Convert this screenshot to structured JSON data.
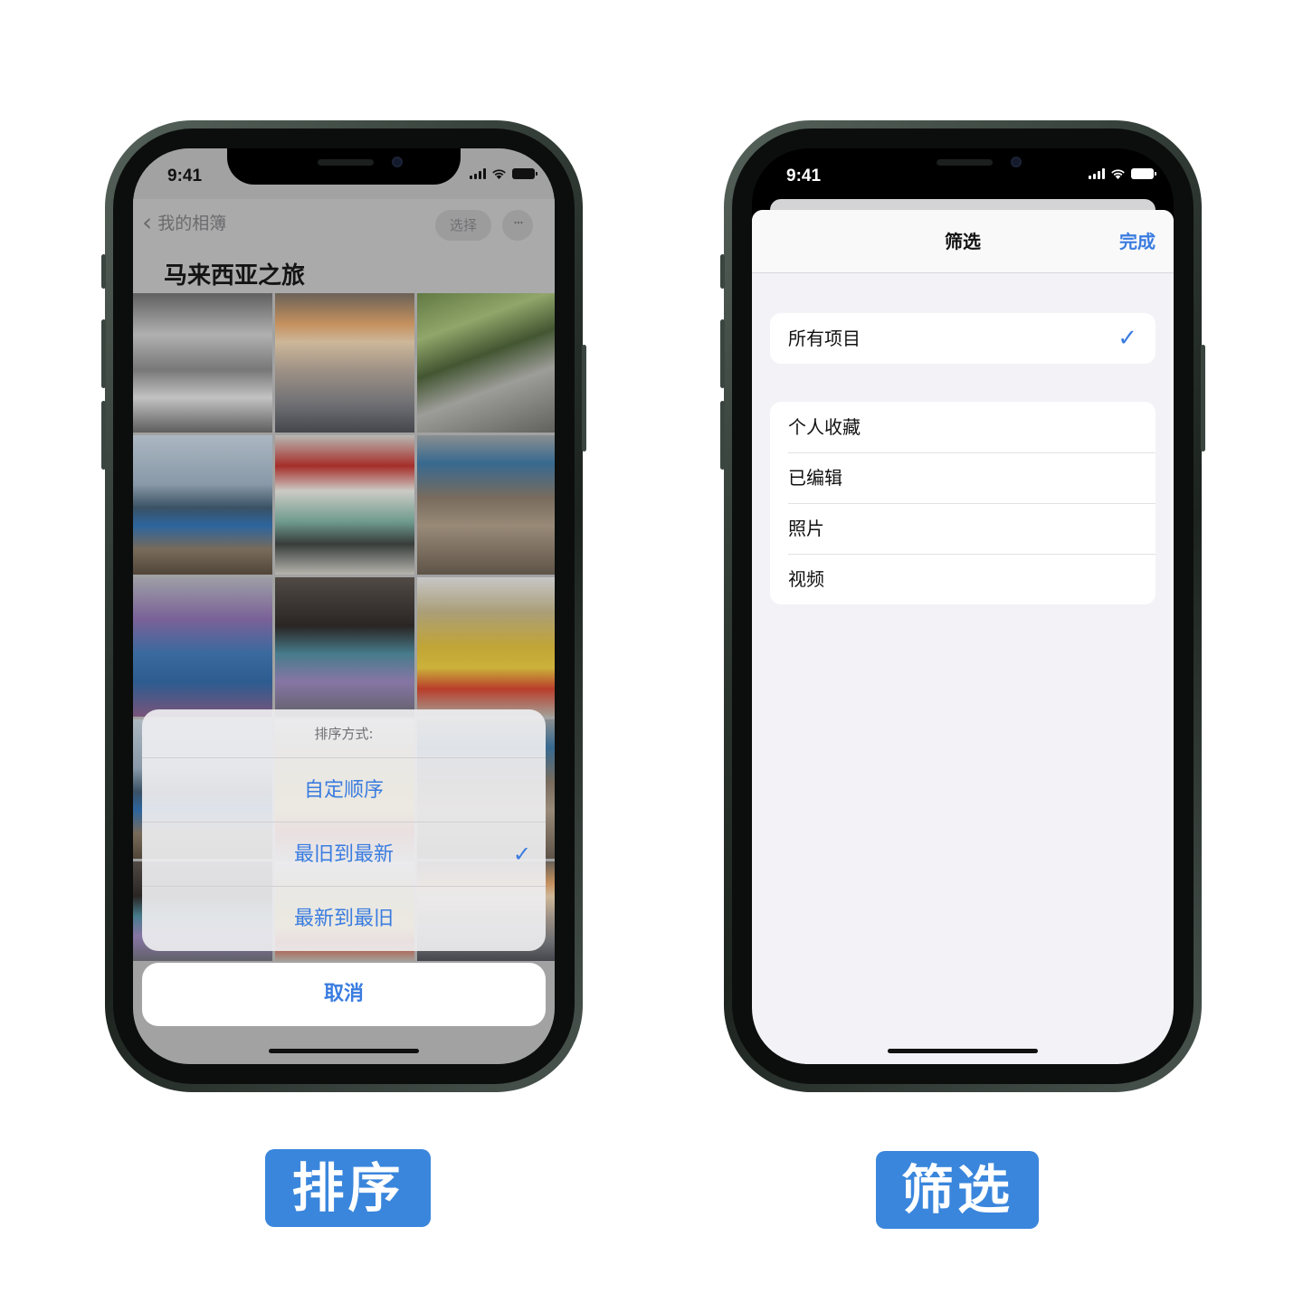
{
  "left_phone": {
    "status_time": "9:41",
    "back_label": "我的相簿",
    "select_button": "选择",
    "more_button": "···",
    "album_title": "马来西亚之旅",
    "sort_sheet": {
      "title": "排序方式:",
      "options": [
        {
          "label": "自定顺序",
          "checked": false
        },
        {
          "label": "最旧到最新",
          "checked": true
        },
        {
          "label": "最新到最旧",
          "checked": false
        }
      ],
      "check_mark": "✓",
      "cancel": "取消"
    }
  },
  "right_phone": {
    "status_time": "9:41",
    "nav_title": "筛选",
    "done": "完成",
    "all_items": {
      "label": "所有项目",
      "checked": true
    },
    "filters": [
      "个人收藏",
      "已编辑",
      "照片",
      "视频"
    ],
    "check_mark": "✓"
  },
  "captions": {
    "left": "排序",
    "right": "筛选"
  },
  "colors": {
    "accent_blue": "#3a7ce0",
    "caption_blue": "#3a86dc"
  }
}
